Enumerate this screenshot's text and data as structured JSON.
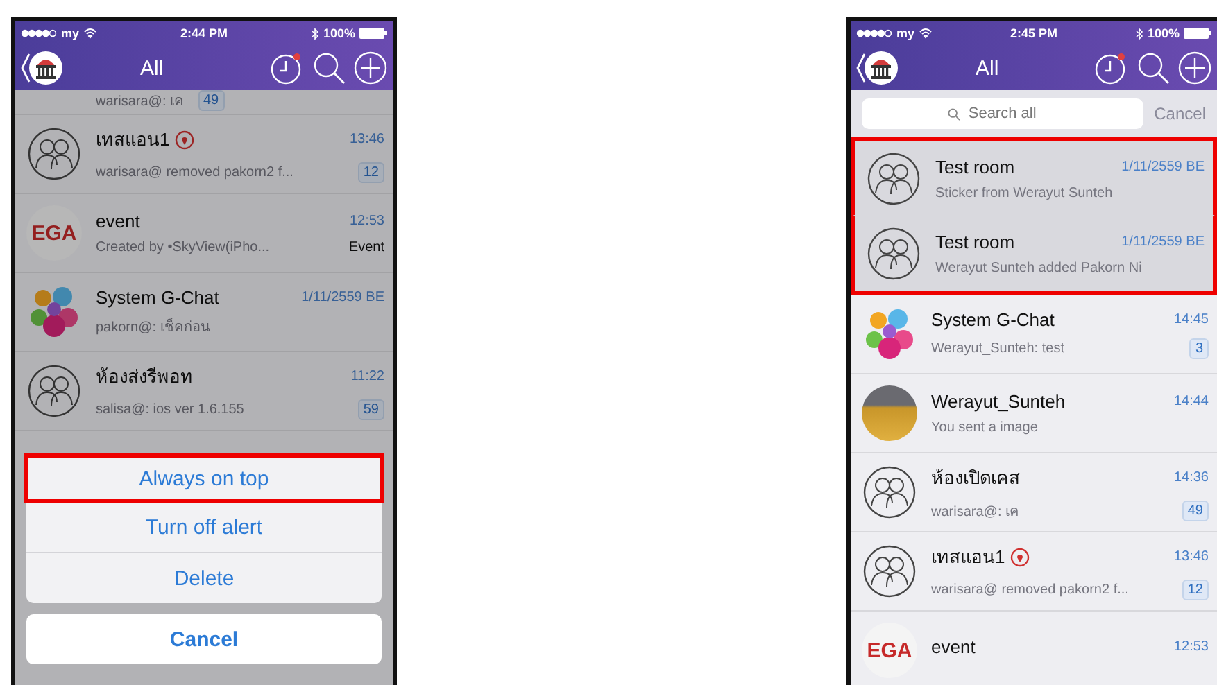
{
  "phones": [
    {
      "status_bar": {
        "carrier": "my",
        "time": "2:44 PM",
        "battery": "100%"
      },
      "nav": {
        "title": "All"
      },
      "dimmed": true,
      "rows": [
        {
          "kind": "partial",
          "subtitle": "warisara@: เค",
          "badge": "49",
          "highlighted": false
        },
        {
          "kind": "full",
          "avatar": {
            "kind": "group"
          },
          "title": "เทสแอน1",
          "location_pin": true,
          "subtitle": "warisara@ removed pakorn2 f...",
          "time": "13:46",
          "badge": "12",
          "highlighted": false
        },
        {
          "kind": "full",
          "avatar": {
            "kind": "logo",
            "text": "EGA"
          },
          "title": "event",
          "location_pin": false,
          "subtitle": "Created by •SkyView(iPho...",
          "time": "12:53",
          "tag": "Event",
          "highlighted": false
        },
        {
          "kind": "full",
          "avatar": {
            "kind": "bubbles"
          },
          "title": "System G-Chat",
          "location_pin": false,
          "subtitle": "pakorn@: เช็คก่อน",
          "time": "1/11/2559 BE",
          "highlighted": false
        },
        {
          "kind": "full",
          "avatar": {
            "kind": "group"
          },
          "title": "ห้องส่งรีพอท",
          "location_pin": false,
          "subtitle": "salisa@: ios ver 1.6.155",
          "time": "11:22",
          "badge": "59",
          "highlighted": false
        }
      ],
      "action_sheet": {
        "options": [
          {
            "label": "Always on top",
            "highlighted": true
          },
          {
            "label": "Turn off alert",
            "highlighted": false
          },
          {
            "label": "Delete",
            "highlighted": false
          }
        ],
        "cancel": "Cancel"
      }
    },
    {
      "status_bar": {
        "carrier": "my",
        "time": "2:45 PM",
        "battery": "100%"
      },
      "nav": {
        "title": "All"
      },
      "dimmed": false,
      "search": {
        "placeholder": "Search all",
        "cancel": "Cancel"
      },
      "rows": [
        {
          "kind": "full",
          "avatar": {
            "kind": "group"
          },
          "title": "Test room",
          "location_pin": false,
          "subtitle": "Sticker from Werayut Sunteh",
          "time": "1/11/2559 BE",
          "highlighted": true
        },
        {
          "kind": "full",
          "avatar": {
            "kind": "group"
          },
          "title": "Test room",
          "location_pin": false,
          "subtitle": "Werayut Sunteh added Pakorn Ni",
          "time": "1/11/2559 BE",
          "highlighted": true
        },
        {
          "kind": "full",
          "avatar": {
            "kind": "bubbles"
          },
          "title": "System G-Chat",
          "location_pin": false,
          "subtitle": "Werayut_Sunteh: test",
          "time": "14:45",
          "badge": "3",
          "highlighted": false
        },
        {
          "kind": "full",
          "avatar": {
            "kind": "photo"
          },
          "title": "Werayut_Sunteh",
          "location_pin": false,
          "subtitle": "You sent a image",
          "time": "14:44",
          "highlighted": false
        },
        {
          "kind": "full",
          "avatar": {
            "kind": "group"
          },
          "title": "ห้องเปิดเคส",
          "location_pin": false,
          "subtitle": "warisara@: เค",
          "time": "14:36",
          "badge": "49",
          "highlighted": false
        },
        {
          "kind": "full",
          "avatar": {
            "kind": "group"
          },
          "title": "เทสแอน1",
          "location_pin": true,
          "subtitle": "warisara@ removed pakorn2 f...",
          "time": "13:46",
          "badge": "12",
          "highlighted": false
        },
        {
          "kind": "full",
          "avatar": {
            "kind": "logo",
            "text": "EGA"
          },
          "title": "event",
          "location_pin": false,
          "time": "12:53",
          "highlighted": false
        }
      ]
    }
  ]
}
